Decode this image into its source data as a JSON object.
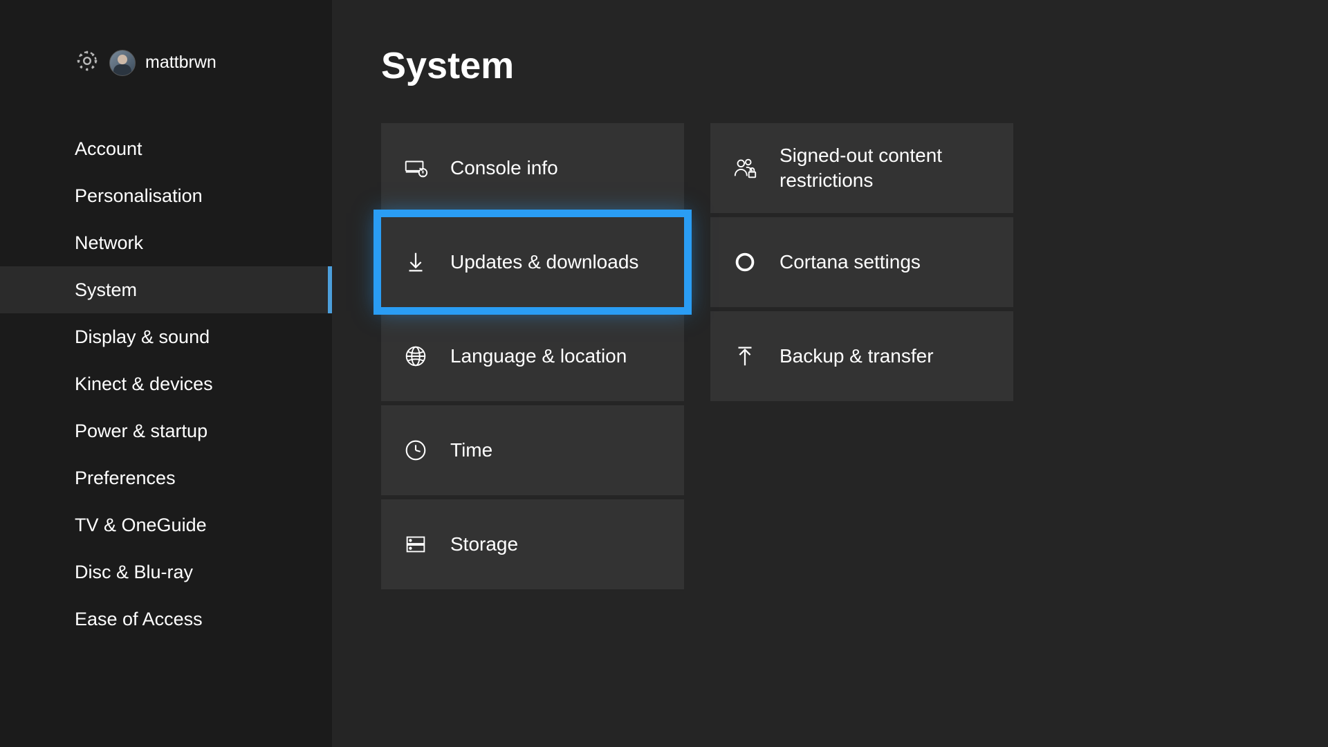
{
  "header": {
    "username": "mattbrwn"
  },
  "page": {
    "title": "System"
  },
  "sidebar": {
    "items": [
      {
        "label": "Account",
        "active": false
      },
      {
        "label": "Personalisation",
        "active": false
      },
      {
        "label": "Network",
        "active": false
      },
      {
        "label": "System",
        "active": true
      },
      {
        "label": "Display & sound",
        "active": false
      },
      {
        "label": "Kinect & devices",
        "active": false
      },
      {
        "label": "Power & startup",
        "active": false
      },
      {
        "label": "Preferences",
        "active": false
      },
      {
        "label": "TV & OneGuide",
        "active": false
      },
      {
        "label": "Disc & Blu-ray",
        "active": false
      },
      {
        "label": "Ease of Access",
        "active": false
      }
    ]
  },
  "tiles": {
    "col1": [
      {
        "label": "Console info",
        "icon": "console-info",
        "selected": false
      },
      {
        "label": "Updates & downloads",
        "icon": "download",
        "selected": true
      },
      {
        "label": "Language & location",
        "icon": "globe",
        "selected": false
      },
      {
        "label": "Time",
        "icon": "clock",
        "selected": false
      },
      {
        "label": "Storage",
        "icon": "storage",
        "selected": false
      }
    ],
    "col2": [
      {
        "label": "Signed-out content restrictions",
        "icon": "people-lock",
        "selected": false
      },
      {
        "label": "Cortana settings",
        "icon": "circle",
        "selected": false
      },
      {
        "label": "Backup & transfer",
        "icon": "upload",
        "selected": false
      }
    ]
  },
  "colors": {
    "accent": "#2a9df4",
    "tile_bg": "#333333",
    "sidebar_bg": "#1b1b1b",
    "main_bg": "#252525"
  }
}
